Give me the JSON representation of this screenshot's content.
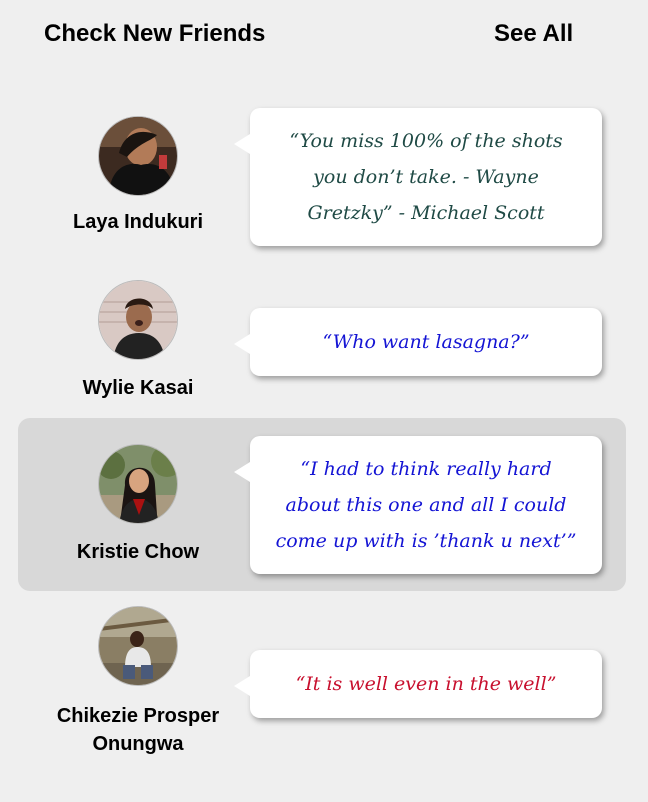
{
  "header": {
    "title": "Check New Friends",
    "see_all": "See All"
  },
  "friends": [
    {
      "name": "Laya Indukuri",
      "quote": "“You miss 100% of the shots you don’t take. - Wayne Gretzky” - Michael Scott",
      "quote_color": "#1f4a45"
    },
    {
      "name": "Wylie Kasai",
      "quote": "“Who want lasagna?”",
      "quote_color": "#1414d4"
    },
    {
      "name": "Kristie Chow",
      "quote": "“I had to think really hard about this one and all I could come up with is ’thank u next’”",
      "quote_color": "#1414d4"
    },
    {
      "name": "Chikezie Prosper Onungwa",
      "quote": "“It is well even in the well”",
      "quote_color": "#c8102e"
    }
  ]
}
